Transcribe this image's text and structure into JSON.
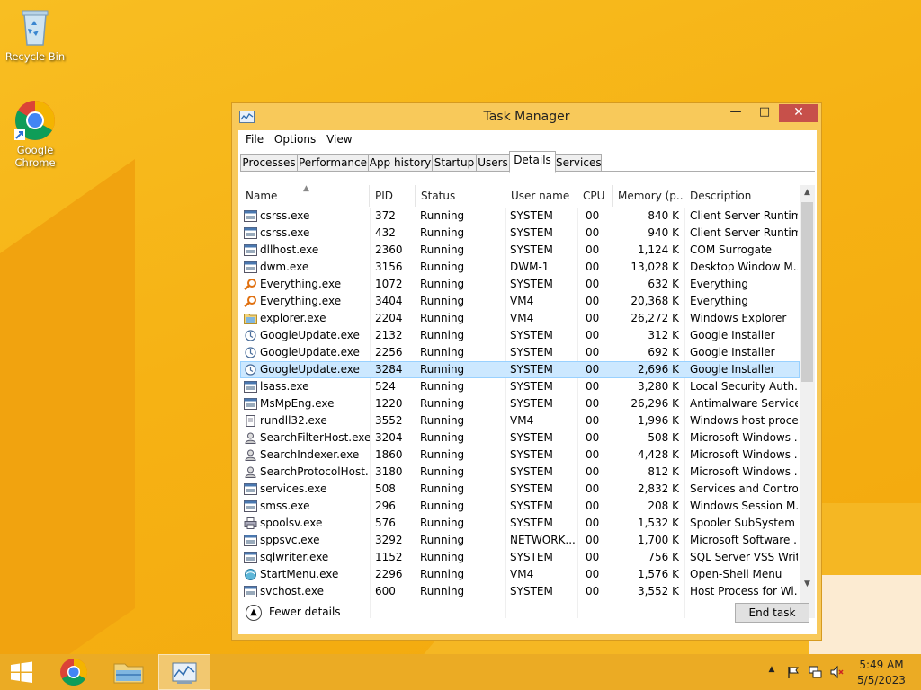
{
  "desktop": {
    "icons": [
      {
        "label": "Recycle Bin",
        "icon": "recycle-bin-icon"
      },
      {
        "label": "Google\nChrome",
        "icon": "chrome-icon"
      }
    ]
  },
  "window": {
    "title": "Task Manager",
    "controls": {
      "minimize": "—",
      "maximize": "□",
      "close": "✕"
    },
    "menu": [
      "File",
      "Options",
      "View"
    ],
    "tabs": [
      "Processes",
      "Performance",
      "App history",
      "Startup",
      "Users",
      "Details",
      "Services"
    ],
    "active_tab": "Details",
    "columns": [
      "Name",
      "PID",
      "Status",
      "User name",
      "CPU",
      "Memory (p...",
      "Description"
    ],
    "rows": [
      {
        "name": "csrss.exe",
        "pid": "372",
        "status": "Running",
        "user": "SYSTEM",
        "cpu": "00",
        "mem": "840 K",
        "desc": "Client Server Runtim...",
        "icon": "generic"
      },
      {
        "name": "csrss.exe",
        "pid": "432",
        "status": "Running",
        "user": "SYSTEM",
        "cpu": "00",
        "mem": "940 K",
        "desc": "Client Server Runtim...",
        "icon": "generic"
      },
      {
        "name": "dllhost.exe",
        "pid": "2360",
        "status": "Running",
        "user": "SYSTEM",
        "cpu": "00",
        "mem": "1,124 K",
        "desc": "COM Surrogate",
        "icon": "generic"
      },
      {
        "name": "dwm.exe",
        "pid": "3156",
        "status": "Running",
        "user": "DWM-1",
        "cpu": "00",
        "mem": "13,028 K",
        "desc": "Desktop Window M...",
        "icon": "generic"
      },
      {
        "name": "Everything.exe",
        "pid": "1072",
        "status": "Running",
        "user": "SYSTEM",
        "cpu": "00",
        "mem": "632 K",
        "desc": "Everything",
        "icon": "search"
      },
      {
        "name": "Everything.exe",
        "pid": "3404",
        "status": "Running",
        "user": "VM4",
        "cpu": "00",
        "mem": "20,368 K",
        "desc": "Everything",
        "icon": "search"
      },
      {
        "name": "explorer.exe",
        "pid": "2204",
        "status": "Running",
        "user": "VM4",
        "cpu": "00",
        "mem": "26,272 K",
        "desc": "Windows Explorer",
        "icon": "folder"
      },
      {
        "name": "GoogleUpdate.exe",
        "pid": "2132",
        "status": "Running",
        "user": "SYSTEM",
        "cpu": "00",
        "mem": "312 K",
        "desc": "Google Installer",
        "icon": "update"
      },
      {
        "name": "GoogleUpdate.exe",
        "pid": "2256",
        "status": "Running",
        "user": "SYSTEM",
        "cpu": "00",
        "mem": "692 K",
        "desc": "Google Installer",
        "icon": "update"
      },
      {
        "name": "GoogleUpdate.exe",
        "pid": "3284",
        "status": "Running",
        "user": "SYSTEM",
        "cpu": "00",
        "mem": "2,696 K",
        "desc": "Google Installer",
        "icon": "update",
        "selected": true
      },
      {
        "name": "lsass.exe",
        "pid": "524",
        "status": "Running",
        "user": "SYSTEM",
        "cpu": "00",
        "mem": "3,280 K",
        "desc": "Local Security Auth...",
        "icon": "generic"
      },
      {
        "name": "MsMpEng.exe",
        "pid": "1220",
        "status": "Running",
        "user": "SYSTEM",
        "cpu": "00",
        "mem": "26,296 K",
        "desc": "Antimalware Service...",
        "icon": "generic"
      },
      {
        "name": "rundll32.exe",
        "pid": "3552",
        "status": "Running",
        "user": "VM4",
        "cpu": "00",
        "mem": "1,996 K",
        "desc": "Windows host proce...",
        "icon": "doc"
      },
      {
        "name": "SearchFilterHost.exe",
        "pid": "3204",
        "status": "Running",
        "user": "SYSTEM",
        "cpu": "00",
        "mem": "508 K",
        "desc": "Microsoft Windows ...",
        "icon": "person"
      },
      {
        "name": "SearchIndexer.exe",
        "pid": "1860",
        "status": "Running",
        "user": "SYSTEM",
        "cpu": "00",
        "mem": "4,428 K",
        "desc": "Microsoft Windows ...",
        "icon": "person"
      },
      {
        "name": "SearchProtocolHost....",
        "pid": "3180",
        "status": "Running",
        "user": "SYSTEM",
        "cpu": "00",
        "mem": "812 K",
        "desc": "Microsoft Windows ...",
        "icon": "person"
      },
      {
        "name": "services.exe",
        "pid": "508",
        "status": "Running",
        "user": "SYSTEM",
        "cpu": "00",
        "mem": "2,832 K",
        "desc": "Services and Control...",
        "icon": "generic"
      },
      {
        "name": "smss.exe",
        "pid": "296",
        "status": "Running",
        "user": "SYSTEM",
        "cpu": "00",
        "mem": "208 K",
        "desc": "Windows Session M...",
        "icon": "generic"
      },
      {
        "name": "spoolsv.exe",
        "pid": "576",
        "status": "Running",
        "user": "SYSTEM",
        "cpu": "00",
        "mem": "1,532 K",
        "desc": "Spooler SubSystem ...",
        "icon": "printer"
      },
      {
        "name": "sppsvc.exe",
        "pid": "3292",
        "status": "Running",
        "user": "NETWORK...",
        "cpu": "00",
        "mem": "1,700 K",
        "desc": "Microsoft Software ...",
        "icon": "generic"
      },
      {
        "name": "sqlwriter.exe",
        "pid": "1152",
        "status": "Running",
        "user": "SYSTEM",
        "cpu": "00",
        "mem": "756 K",
        "desc": "SQL Server VSS Writ...",
        "icon": "generic"
      },
      {
        "name": "StartMenu.exe",
        "pid": "2296",
        "status": "Running",
        "user": "VM4",
        "cpu": "00",
        "mem": "1,576 K",
        "desc": "Open-Shell Menu",
        "icon": "shell"
      },
      {
        "name": "svchost.exe",
        "pid": "600",
        "status": "Running",
        "user": "SYSTEM",
        "cpu": "00",
        "mem": "3,552 K",
        "desc": "Host Process for Wi...",
        "icon": "generic"
      }
    ],
    "fewer_details": "Fewer details",
    "end_task": "End task"
  },
  "taskbar": {
    "items": [
      "start-button",
      "chrome",
      "file-explorer",
      "task-manager"
    ],
    "clock_time": "5:49 AM",
    "clock_date": "5/5/2023"
  },
  "colors": {
    "desktop": "#f6b416",
    "window_frame": "#f8c95a",
    "close_button": "#c7504a",
    "selected_row": "#cce8ff"
  }
}
